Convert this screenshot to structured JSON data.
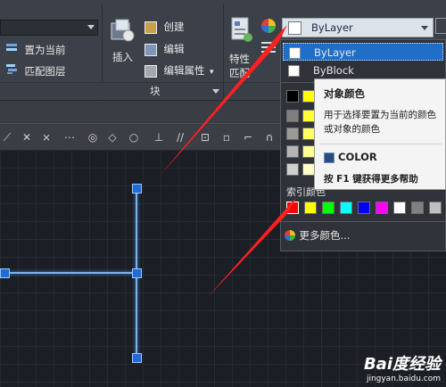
{
  "ribbon": {
    "set_current_label": "置为当前",
    "match_layer_label": "匹配图层",
    "insert_label": "插入",
    "create_label": "创建",
    "edit_label": "编辑",
    "edit_attr_label": "编辑属性",
    "block_panel_title": "块",
    "properties_label": "特性",
    "match_label": "匹配",
    "attribute_more": "▾"
  },
  "color_combo": {
    "selected": "ByLayer",
    "options": [
      {
        "label": "ByLayer",
        "swatch": "#ffffff"
      },
      {
        "label": "ByBlock",
        "swatch": "#ffffff"
      }
    ],
    "more_colors_label": "更多颜色..."
  },
  "tooltip": {
    "title": "对象颜色",
    "description": "用于选择要置为当前的颜色或对象的颜色",
    "command_label": "COLOR",
    "help_text": "按 F1 键获得更多帮助"
  },
  "index_colors": {
    "label": "索引颜色",
    "swatches": [
      "#ff0000",
      "#ffff00",
      "#00ff00",
      "#00ffff",
      "#0000ff",
      "#ff00ff",
      "#ffffff",
      "#808080",
      "#c0c0c0"
    ],
    "left_column": [
      "#000000",
      "#7f7f7f",
      "#9a9a9a",
      "#b5b5b5",
      "#cfcfcf"
    ],
    "yellow_column": [
      "#ffff00",
      "#ffff33",
      "#ffff66",
      "#ffff99",
      "#ffffcc"
    ]
  },
  "watermark": {
    "brand": "Bai度经验",
    "url": "jingyan.baidu.com"
  },
  "annotation_color": "#ff2020"
}
